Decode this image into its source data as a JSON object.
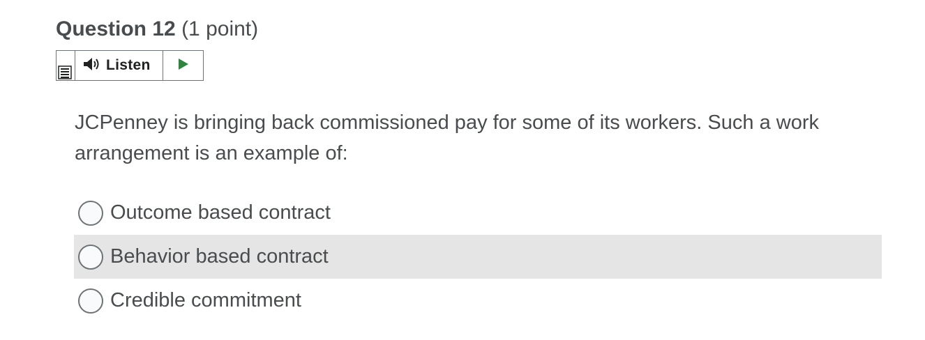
{
  "question": {
    "title": "Question 12",
    "points": "(1 point)",
    "text": "JCPenney is bringing back commissioned pay for some of its workers. Such a work arrangement is an example of:"
  },
  "listen": {
    "label": "Listen",
    "menu_icon": "menu-icon",
    "speaker_icon": "speaker-icon",
    "play_icon": "play-icon",
    "play_color": "#2e8540"
  },
  "options": [
    {
      "label": "Outcome based contract",
      "selected": false,
      "highlighted": false
    },
    {
      "label": "Behavior based contract",
      "selected": false,
      "highlighted": true
    },
    {
      "label": "Credible commitment",
      "selected": false,
      "highlighted": false
    }
  ]
}
